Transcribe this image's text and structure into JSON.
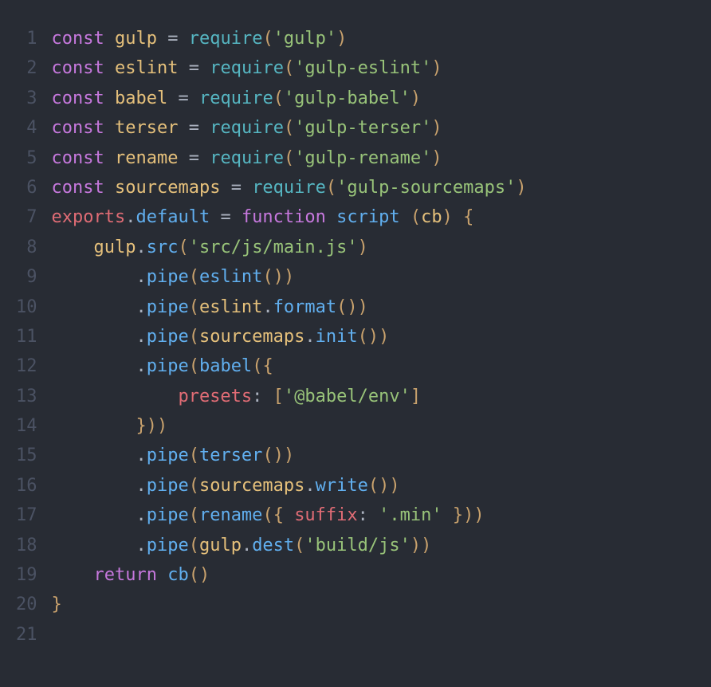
{
  "lines": [
    {
      "n": "1",
      "tokens": [
        [
          "kw",
          "const"
        ],
        [
          "punct",
          " "
        ],
        [
          "var",
          "gulp"
        ],
        [
          "punct",
          " "
        ],
        [
          "op",
          "="
        ],
        [
          "punct",
          " "
        ],
        [
          "fn",
          "require"
        ],
        [
          "paren",
          "("
        ],
        [
          "str",
          "'gulp'"
        ],
        [
          "paren",
          ")"
        ]
      ]
    },
    {
      "n": "2",
      "tokens": [
        [
          "kw",
          "const"
        ],
        [
          "punct",
          " "
        ],
        [
          "var",
          "eslint"
        ],
        [
          "punct",
          " "
        ],
        [
          "op",
          "="
        ],
        [
          "punct",
          " "
        ],
        [
          "fn",
          "require"
        ],
        [
          "paren",
          "("
        ],
        [
          "str",
          "'gulp-eslint'"
        ],
        [
          "paren",
          ")"
        ]
      ]
    },
    {
      "n": "3",
      "tokens": [
        [
          "kw",
          "const"
        ],
        [
          "punct",
          " "
        ],
        [
          "var",
          "babel"
        ],
        [
          "punct",
          " "
        ],
        [
          "op",
          "="
        ],
        [
          "punct",
          " "
        ],
        [
          "fn",
          "require"
        ],
        [
          "paren",
          "("
        ],
        [
          "str",
          "'gulp-babel'"
        ],
        [
          "paren",
          ")"
        ]
      ]
    },
    {
      "n": "4",
      "tokens": [
        [
          "kw",
          "const"
        ],
        [
          "punct",
          " "
        ],
        [
          "var",
          "terser"
        ],
        [
          "punct",
          " "
        ],
        [
          "op",
          "="
        ],
        [
          "punct",
          " "
        ],
        [
          "fn",
          "require"
        ],
        [
          "paren",
          "("
        ],
        [
          "str",
          "'gulp-terser'"
        ],
        [
          "paren",
          ")"
        ]
      ]
    },
    {
      "n": "5",
      "tokens": [
        [
          "kw",
          "const"
        ],
        [
          "punct",
          " "
        ],
        [
          "var",
          "rename"
        ],
        [
          "punct",
          " "
        ],
        [
          "op",
          "="
        ],
        [
          "punct",
          " "
        ],
        [
          "fn",
          "require"
        ],
        [
          "paren",
          "("
        ],
        [
          "str",
          "'gulp-rename'"
        ],
        [
          "paren",
          ")"
        ]
      ]
    },
    {
      "n": "6",
      "tokens": [
        [
          "kw",
          "const"
        ],
        [
          "punct",
          " "
        ],
        [
          "var",
          "sourcemaps"
        ],
        [
          "punct",
          " "
        ],
        [
          "op",
          "="
        ],
        [
          "punct",
          " "
        ],
        [
          "fn",
          "require"
        ],
        [
          "paren",
          "("
        ],
        [
          "str",
          "'gulp-sourcemaps'"
        ],
        [
          "paren",
          ")"
        ]
      ]
    },
    {
      "n": "7",
      "tokens": [
        [
          "punct",
          ""
        ]
      ]
    },
    {
      "n": "8",
      "tokens": [
        [
          "prop",
          "exports"
        ],
        [
          "punct",
          "."
        ],
        [
          "call",
          "default"
        ],
        [
          "punct",
          " "
        ],
        [
          "op",
          "="
        ],
        [
          "punct",
          " "
        ],
        [
          "kw",
          "function"
        ],
        [
          "punct",
          " "
        ],
        [
          "call",
          "script"
        ],
        [
          "punct",
          " "
        ],
        [
          "paren",
          "("
        ],
        [
          "var",
          "cb"
        ],
        [
          "paren",
          ")"
        ],
        [
          "punct",
          " "
        ],
        [
          "paren",
          "{"
        ]
      ]
    },
    {
      "n": "9",
      "tokens": [
        [
          "punct",
          "    "
        ],
        [
          "var",
          "gulp"
        ],
        [
          "punct",
          "."
        ],
        [
          "call",
          "src"
        ],
        [
          "paren",
          "("
        ],
        [
          "str",
          "'src/js/main.js'"
        ],
        [
          "paren",
          ")"
        ]
      ]
    },
    {
      "n": "10",
      "tokens": [
        [
          "punct",
          "        "
        ],
        [
          "punct",
          "."
        ],
        [
          "call",
          "pipe"
        ],
        [
          "paren",
          "("
        ],
        [
          "call",
          "eslint"
        ],
        [
          "paren",
          "("
        ],
        [
          "paren",
          ")"
        ],
        [
          "paren",
          ")"
        ]
      ]
    },
    {
      "n": "11",
      "tokens": [
        [
          "punct",
          "        "
        ],
        [
          "punct",
          "."
        ],
        [
          "call",
          "pipe"
        ],
        [
          "paren",
          "("
        ],
        [
          "var",
          "eslint"
        ],
        [
          "punct",
          "."
        ],
        [
          "call",
          "format"
        ],
        [
          "paren",
          "("
        ],
        [
          "paren",
          ")"
        ],
        [
          "paren",
          ")"
        ]
      ]
    },
    {
      "n": "12",
      "tokens": [
        [
          "punct",
          "        "
        ],
        [
          "punct",
          "."
        ],
        [
          "call",
          "pipe"
        ],
        [
          "paren",
          "("
        ],
        [
          "var",
          "sourcemaps"
        ],
        [
          "punct",
          "."
        ],
        [
          "call",
          "init"
        ],
        [
          "paren",
          "("
        ],
        [
          "paren",
          ")"
        ],
        [
          "paren",
          ")"
        ]
      ]
    },
    {
      "n": "13",
      "tokens": [
        [
          "punct",
          "        "
        ],
        [
          "punct",
          "."
        ],
        [
          "call",
          "pipe"
        ],
        [
          "paren",
          "("
        ],
        [
          "call",
          "babel"
        ],
        [
          "paren",
          "("
        ],
        [
          "paren",
          "{"
        ]
      ]
    },
    {
      "n": "14",
      "tokens": [
        [
          "punct",
          "            "
        ],
        [
          "prop",
          "presets"
        ],
        [
          "op",
          ":"
        ],
        [
          "punct",
          " "
        ],
        [
          "paren",
          "["
        ],
        [
          "str",
          "'@babel/env'"
        ],
        [
          "paren",
          "]"
        ]
      ]
    },
    {
      "n": "15",
      "tokens": [
        [
          "punct",
          "        "
        ],
        [
          "paren",
          "}"
        ],
        [
          "paren",
          ")"
        ],
        [
          "paren",
          ")"
        ]
      ]
    },
    {
      "n": "16",
      "tokens": [
        [
          "punct",
          "        "
        ],
        [
          "punct",
          "."
        ],
        [
          "call",
          "pipe"
        ],
        [
          "paren",
          "("
        ],
        [
          "call",
          "terser"
        ],
        [
          "paren",
          "("
        ],
        [
          "paren",
          ")"
        ],
        [
          "paren",
          ")"
        ]
      ]
    },
    {
      "n": "17",
      "tokens": [
        [
          "punct",
          "        "
        ],
        [
          "punct",
          "."
        ],
        [
          "call",
          "pipe"
        ],
        [
          "paren",
          "("
        ],
        [
          "var",
          "sourcemaps"
        ],
        [
          "punct",
          "."
        ],
        [
          "call",
          "write"
        ],
        [
          "paren",
          "("
        ],
        [
          "paren",
          ")"
        ],
        [
          "paren",
          ")"
        ]
      ]
    },
    {
      "n": "18",
      "tokens": [
        [
          "punct",
          "        "
        ],
        [
          "punct",
          "."
        ],
        [
          "call",
          "pipe"
        ],
        [
          "paren",
          "("
        ],
        [
          "call",
          "rename"
        ],
        [
          "paren",
          "("
        ],
        [
          "paren",
          "{"
        ],
        [
          "punct",
          " "
        ],
        [
          "prop",
          "suffix"
        ],
        [
          "op",
          ":"
        ],
        [
          "punct",
          " "
        ],
        [
          "str",
          "'.min'"
        ],
        [
          "punct",
          " "
        ],
        [
          "paren",
          "}"
        ],
        [
          "paren",
          ")"
        ],
        [
          "paren",
          ")"
        ]
      ]
    },
    {
      "n": "19",
      "tokens": [
        [
          "punct",
          "        "
        ],
        [
          "punct",
          "."
        ],
        [
          "call",
          "pipe"
        ],
        [
          "paren",
          "("
        ],
        [
          "var",
          "gulp"
        ],
        [
          "punct",
          "."
        ],
        [
          "call",
          "dest"
        ],
        [
          "paren",
          "("
        ],
        [
          "str",
          "'build/js'"
        ],
        [
          "paren",
          ")"
        ],
        [
          "paren",
          ")"
        ]
      ]
    },
    {
      "n": "20",
      "tokens": [
        [
          "punct",
          "    "
        ],
        [
          "kw",
          "return"
        ],
        [
          "punct",
          " "
        ],
        [
          "call",
          "cb"
        ],
        [
          "paren",
          "("
        ],
        [
          "paren",
          ")"
        ]
      ]
    },
    {
      "n": "21",
      "tokens": [
        [
          "paren",
          "}"
        ]
      ]
    }
  ]
}
